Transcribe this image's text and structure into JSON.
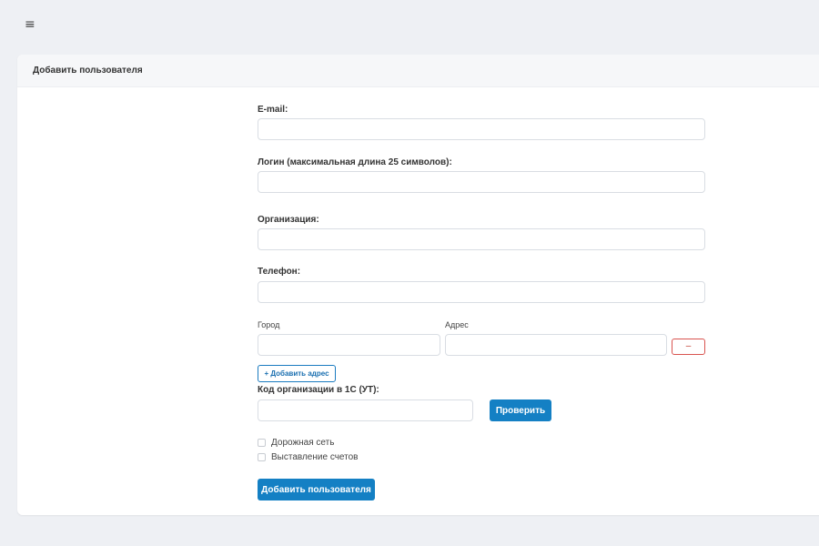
{
  "topbar": {
    "menu_icon": "≡"
  },
  "card": {
    "title": "Добавить пользователя"
  },
  "form": {
    "email_label": "E-mail:",
    "email_value": "",
    "login_label": "Логин (максимальная длина 25 символов):",
    "login_value": "",
    "org_label": "Организация:",
    "org_value": "",
    "phone_label": "Телефон:",
    "phone_value": "",
    "address": {
      "city_label": "Город",
      "city_value": "",
      "addr_label": "Адрес",
      "addr_value": "",
      "remove_label": "–"
    },
    "add_address_label": "+ Добавить адрес",
    "code_label": "Код организации в 1С (УТ):",
    "code_value": "",
    "check_label": "Проверить",
    "checkboxes": [
      {
        "label": "Дорожная сеть",
        "checked": false
      },
      {
        "label": "Выставление счетов",
        "checked": false
      }
    ],
    "submit_label": "Добавить пользователя"
  },
  "colors": {
    "background": "#eef0f4",
    "primary": "#1480c4",
    "danger": "#d9534f"
  }
}
